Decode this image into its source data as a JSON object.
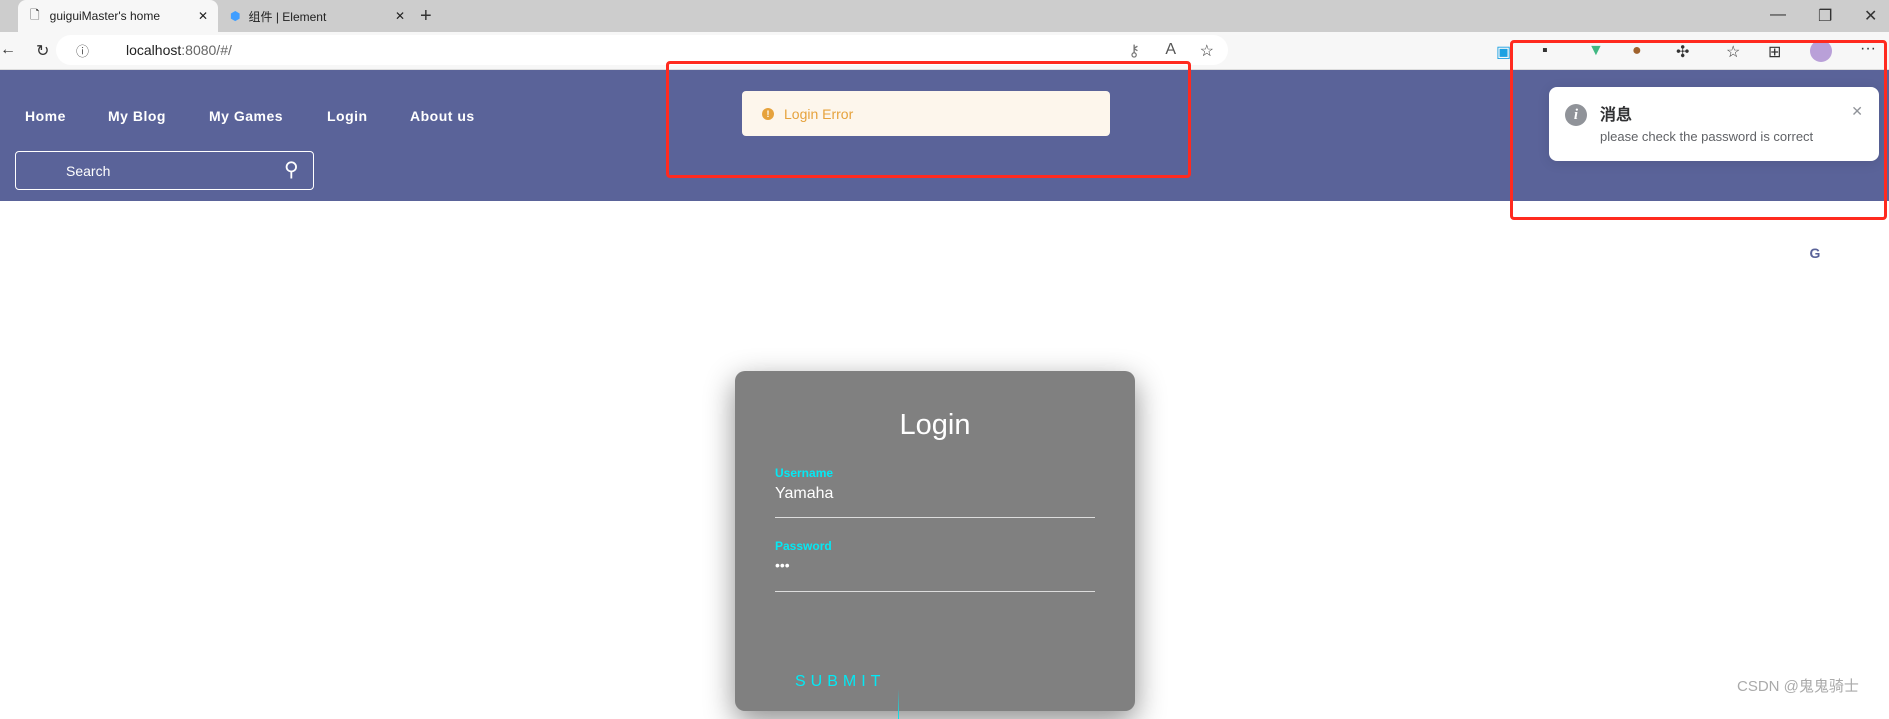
{
  "browser": {
    "tabs": [
      {
        "title": "guiguiMaster's home",
        "icon": "page-icon"
      },
      {
        "title": "组件 | Element",
        "icon": "element-icon"
      }
    ],
    "url_host": "localhost",
    "url_rest": ":8080/#/"
  },
  "nav": {
    "items": [
      "Home",
      "My Blog",
      "My Games",
      "Login",
      "About us"
    ],
    "search_placeholder": "Search"
  },
  "message": {
    "type": "warning",
    "text": "Login Error",
    "color": "#e6a23c"
  },
  "notification": {
    "title": "消息",
    "text": "please check the password is correct",
    "icon": "info-icon"
  },
  "social_icons": [
    "bilibili-icon",
    "wechat-icon",
    "qq-icon",
    "gitee-icon",
    "mail-icon"
  ],
  "login": {
    "title": "Login",
    "username_label": "Username",
    "username_value": "Yamaha",
    "password_label": "Password",
    "password_value": "•••",
    "submit": "SUBMIT"
  },
  "watermark": "CSDN @鬼鬼骑士",
  "colors": {
    "header": "#5a6399",
    "accent": "#03e9f4",
    "card": "#808080",
    "annotation": "#ff2a1f"
  }
}
